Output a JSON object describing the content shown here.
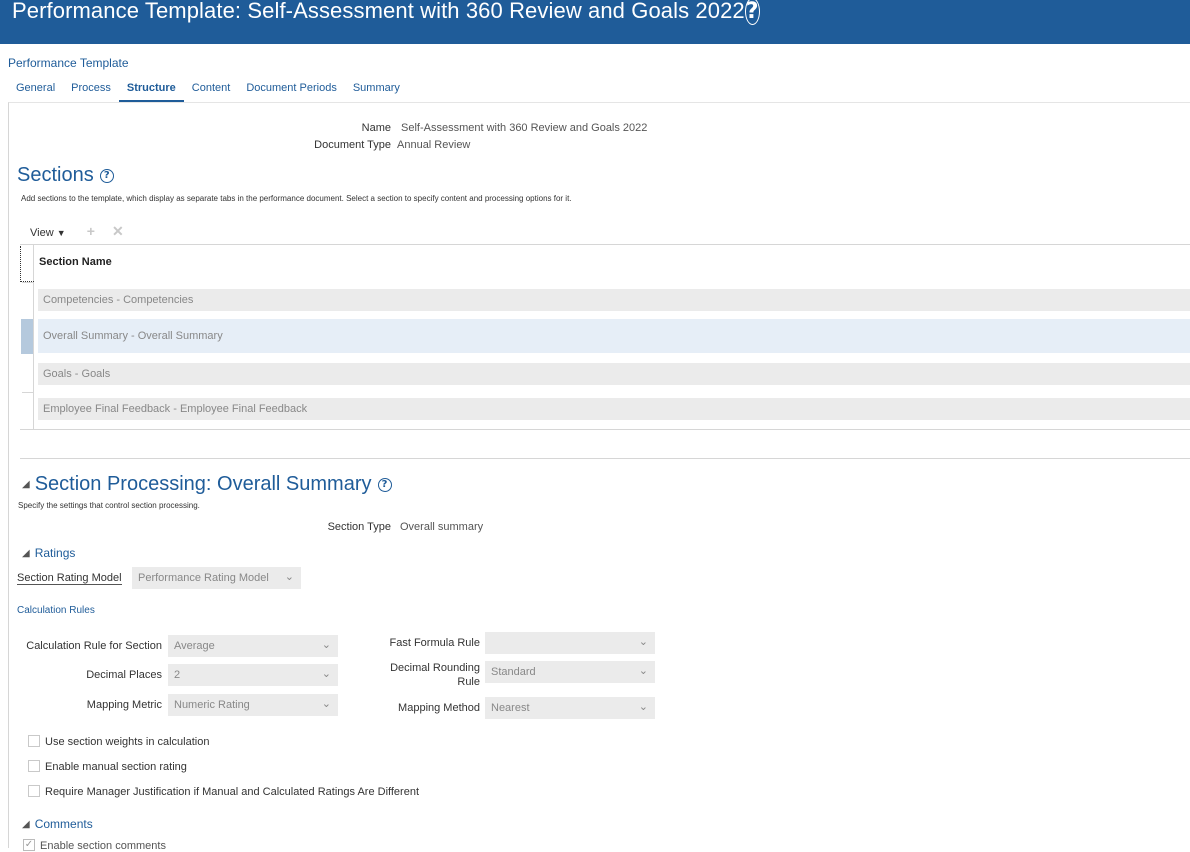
{
  "header": {
    "title": "Performance Template: Self-Assessment with 360 Review and Goals 2022"
  },
  "breadcrumb": "Performance Template",
  "tabs": [
    {
      "label": "General"
    },
    {
      "label": "Process"
    },
    {
      "label": "Structure",
      "active": true
    },
    {
      "label": "Content"
    },
    {
      "label": "Document Periods"
    },
    {
      "label": "Summary"
    }
  ],
  "template_info": {
    "name_label": "Name",
    "name_value": "Self-Assessment with 360 Review and Goals 2022",
    "doctype_label": "Document Type",
    "doctype_value": "Annual Review"
  },
  "sections": {
    "title": "Sections",
    "description": "Add sections to the template, which display as separate tabs in the performance document. Select a section to specify content and processing options for it.",
    "view_label": "View",
    "column_header": "Section Name",
    "rows": [
      "Competencies  -  Competencies",
      "Overall Summary  -  Overall Summary",
      "Goals  -  Goals",
      "Employee Final Feedback  -  Employee Final Feedback"
    ],
    "selected_index": 1
  },
  "processing": {
    "title": "Section Processing: Overall Summary",
    "description": "Specify the settings that control section processing.",
    "section_type_label": "Section Type",
    "section_type_value": "Overall summary",
    "ratings_label": "Ratings",
    "rating_model_label": "Section Rating Model",
    "rating_model_value": "Performance Rating Model",
    "calc_rules_label": "Calculation Rules",
    "calc_rule_label": "Calculation Rule for Section",
    "calc_rule_value": "Average",
    "decimal_places_label": "Decimal Places",
    "decimal_places_value": "2",
    "mapping_metric_label": "Mapping Metric",
    "mapping_metric_value": "Numeric Rating",
    "fast_formula_label": "Fast Formula Rule",
    "fast_formula_value": "",
    "rounding_label_1": "Decimal Rounding",
    "rounding_label_2": "Rule",
    "rounding_value": "Standard",
    "mapping_method_label": "Mapping Method",
    "mapping_method_value": "Nearest",
    "checkboxes": [
      {
        "label": "Use section weights in calculation",
        "checked": false
      },
      {
        "label": "Enable manual section rating",
        "checked": false
      },
      {
        "label": "Require Manager Justification if Manual and Calculated Ratings Are Different",
        "checked": false
      }
    ],
    "comments_label": "Comments",
    "enable_comments_label": "Enable section comments"
  },
  "icons": {
    "help": "help-icon",
    "add": "add-icon",
    "delete": "delete-icon",
    "collapse": "collapse-triangle-icon",
    "dropdown": "chevron-down-icon"
  },
  "colors": {
    "header_bg": "#1f5c99",
    "accent": "#1f5c99",
    "field_bg": "#ebebeb",
    "selected_row": "#e6eef7"
  }
}
